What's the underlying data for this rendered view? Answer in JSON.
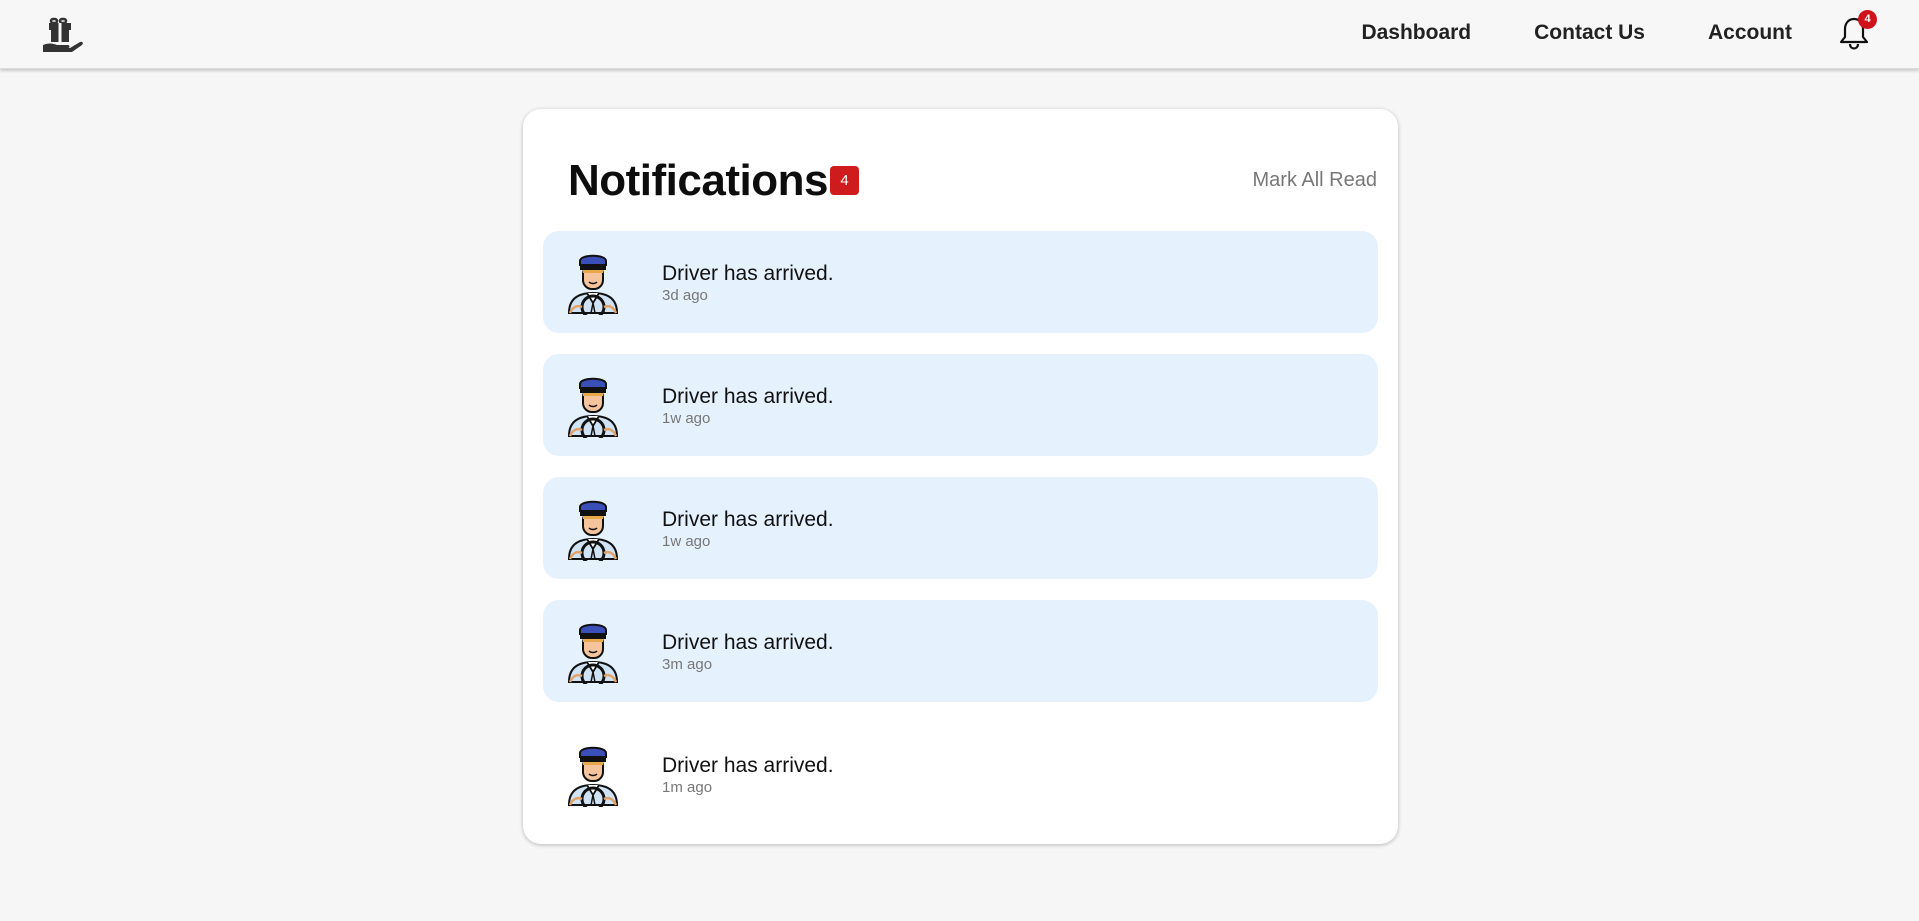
{
  "header": {
    "logo_icon": "gift-in-hand-icon",
    "nav": [
      {
        "label": "Dashboard"
      },
      {
        "label": "Contact Us"
      },
      {
        "label": "Account"
      }
    ],
    "bell_icon": "bell-icon",
    "bell_count": "4"
  },
  "card": {
    "title": "Notifications",
    "unread_count": "4",
    "mark_all_label": "Mark All Read"
  },
  "notifications": [
    {
      "message": "Driver has arrived.",
      "time": "3d ago",
      "unread": true,
      "avatar_icon": "driver-avatar-icon"
    },
    {
      "message": "Driver has arrived.",
      "time": "1w ago",
      "unread": true,
      "avatar_icon": "driver-avatar-icon"
    },
    {
      "message": "Driver has arrived.",
      "time": "1w ago",
      "unread": true,
      "avatar_icon": "driver-avatar-icon"
    },
    {
      "message": "Driver has arrived.",
      "time": "3m ago",
      "unread": true,
      "avatar_icon": "driver-avatar-icon"
    },
    {
      "message": "Driver has arrived.",
      "time": "1m ago",
      "unread": false,
      "avatar_icon": "driver-avatar-icon"
    }
  ],
  "colors": {
    "unread_bg": "#e5f1fd",
    "badge_red": "#cf1b1b",
    "page_bg": "#f6f6f6"
  }
}
